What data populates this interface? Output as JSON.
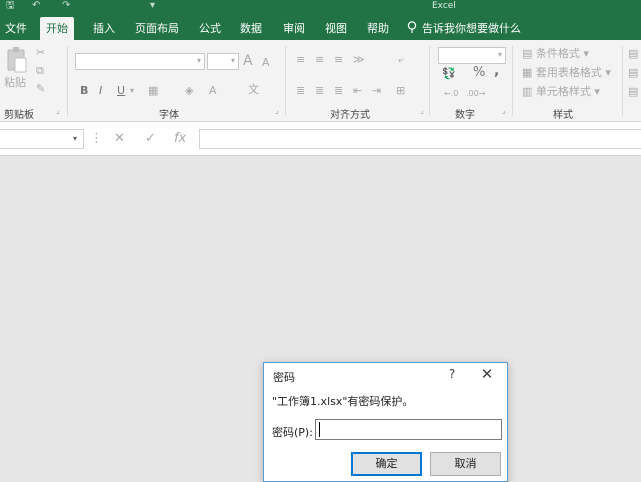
{
  "app": {
    "title": "Excel"
  },
  "quick_access": {
    "save": "🖫",
    "undo": "↶",
    "redo": "↷",
    "more": "▾"
  },
  "tabs": [
    {
      "label": "文件",
      "active": false
    },
    {
      "label": "开始",
      "active": true
    },
    {
      "label": "插入",
      "active": false
    },
    {
      "label": "页面布局",
      "active": false
    },
    {
      "label": "公式",
      "active": false
    },
    {
      "label": "数据",
      "active": false
    },
    {
      "label": "审阅",
      "active": false
    },
    {
      "label": "视图",
      "active": false
    },
    {
      "label": "帮助",
      "active": false
    }
  ],
  "tell_me": {
    "icon": "lightbulb-icon",
    "text": "告诉我你想要做什么"
  },
  "ribbon": {
    "groups": {
      "clipboard": "剪贴板",
      "font": "字体",
      "alignment": "对齐方式",
      "number": "数字",
      "styles": "样式"
    },
    "paste_label": "粘贴",
    "font_buttons": {
      "bold": "B",
      "italic": "I",
      "underline": "U",
      "grow": "A",
      "shrink": "A"
    },
    "number_symbols": {
      "percent": "%",
      "comma": ","
    },
    "styles_items": [
      "条件格式 ▾",
      "套用表格格式 ▾",
      "单元格样式 ▾"
    ]
  },
  "formula_bar": {
    "cancel": "✕",
    "enter": "✓",
    "fx": "fx",
    "colon": "⋮"
  },
  "dialog": {
    "title": "密码",
    "help": "?",
    "close": "✕",
    "message": "\"工作簿1.xlsx\"有密码保护。",
    "password_label": "密码(P):",
    "password_value": "",
    "ok_label": "确定",
    "cancel_label": "取消"
  },
  "colors": {
    "accent": "#217346",
    "dialog_border": "#5b9bd5",
    "primary_button_border": "#0078d7"
  }
}
